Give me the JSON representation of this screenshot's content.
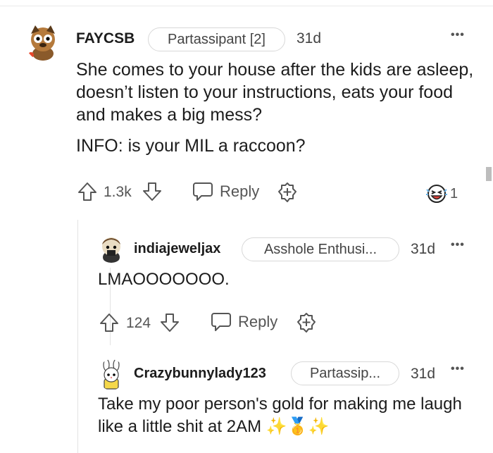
{
  "comments": [
    {
      "username": "FAYCSB",
      "flair": "Partassipant [2]",
      "age": "31d",
      "more": "•••",
      "paragraphs": [
        "She comes to your house after the kids are asleep, doesn’t listen to your instructions, eats your food and makes a big mess?",
        "INFO: is your MIL a raccoon?"
      ],
      "score": "1.3k",
      "reply_label": "Reply",
      "award_count": "1"
    },
    {
      "username": "indiajeweljax",
      "flair": "Asshole Enthusi...",
      "age": "31d",
      "more": "•••",
      "paragraphs": [
        "LMAOOOOOOO."
      ],
      "score": "124",
      "reply_label": "Reply"
    },
    {
      "username": "Crazybunnylady123",
      "flair": "Partassip...",
      "age": "31d",
      "more": "•••",
      "paragraphs": [
        "Take my poor person's gold for making me laugh like a little shit at 2AM ✨🥇✨"
      ]
    }
  ],
  "colors": {
    "text": "#1c1c1c",
    "muted": "#555555",
    "border": "#d8d8d8"
  }
}
